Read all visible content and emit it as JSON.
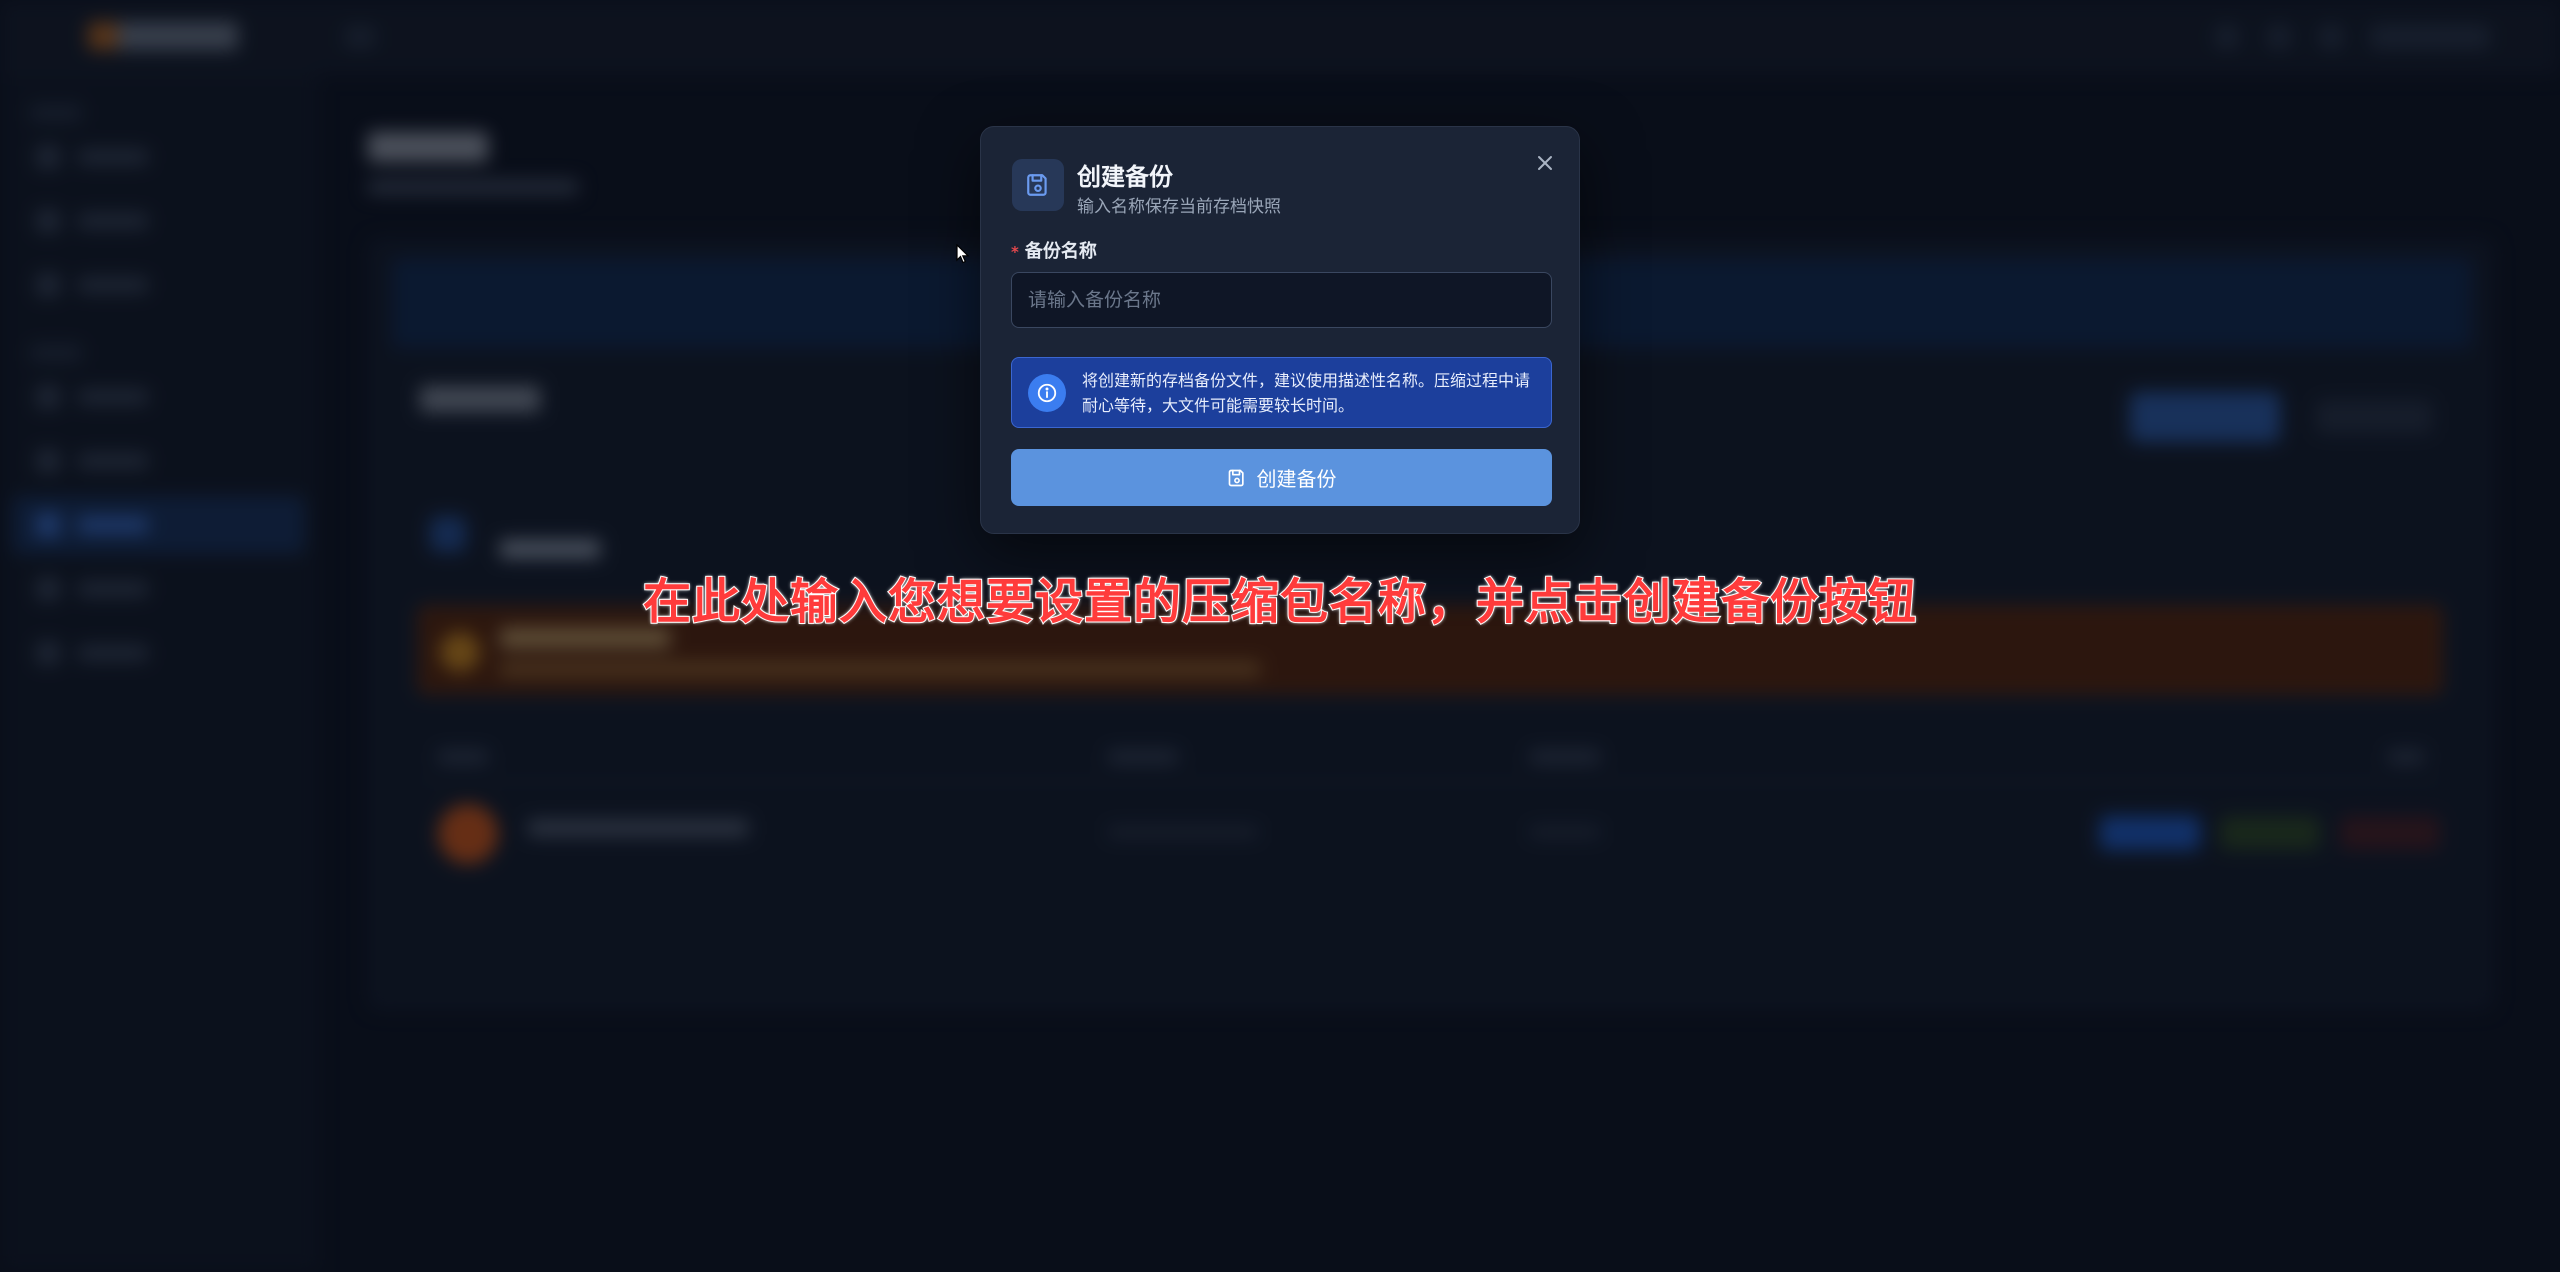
{
  "dialog": {
    "title": "创建备份",
    "subtitle": "输入名称保存当前存档快照",
    "close_icon": "close-icon",
    "header_icon": "save-icon",
    "field": {
      "required_mark": "*",
      "label": "备份名称",
      "placeholder": "请输入备份名称",
      "value": ""
    },
    "info": {
      "icon": "info-icon",
      "text": "将创建新的存档备份文件，建议使用描述性名称。压缩过程中请耐心等待，大文件可能需要较长时间。"
    },
    "submit": {
      "icon": "save-icon",
      "label": "创建备份"
    }
  },
  "caption": "在此处输入您想要设置的压缩包名称，并点击创建备份按钮",
  "colors": {
    "accent": "#5b93de",
    "info_bg": "#1c3f9c",
    "caption": "#ff3b3b",
    "required": "#e5484d"
  }
}
